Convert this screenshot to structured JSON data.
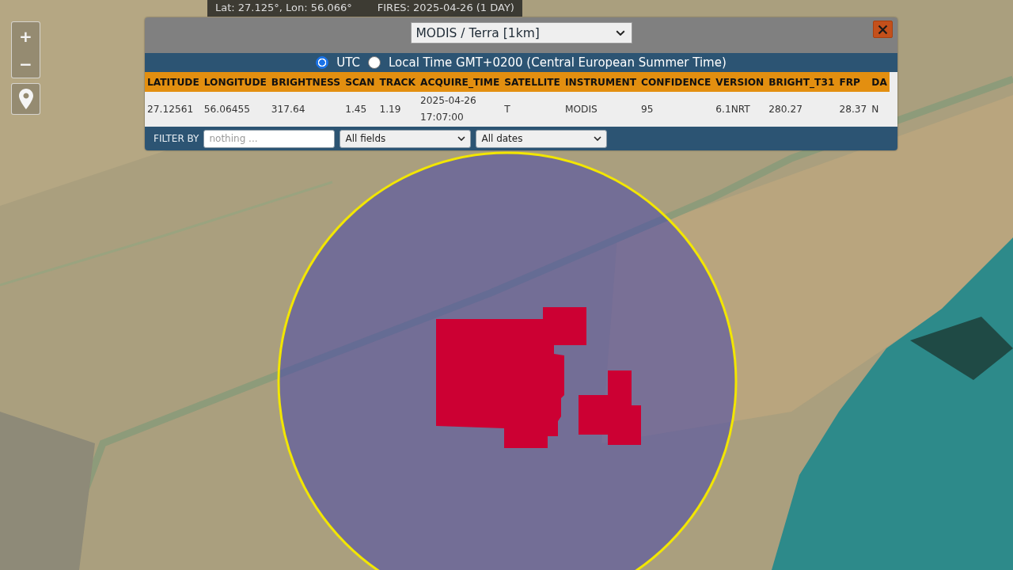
{
  "status_bar": {
    "coordinates": "Lat: 27.125°, Lon: 56.066°",
    "fires": "FIRES: 2025-04-26 (1 DAY)"
  },
  "map_controls": {
    "zoom_in": "+",
    "zoom_out": "−"
  },
  "popup": {
    "source_select": {
      "value": "MODIS / Terra [1km]"
    },
    "time_options": [
      {
        "label": "UTC",
        "selected": true
      },
      {
        "label": "Local Time GMT+0200 (Central European Summer Time)",
        "selected": false
      }
    ],
    "table": {
      "columns": [
        "LATITUDE",
        "LONGITUDE",
        "BRIGHTNESS",
        "SCAN",
        "TRACK",
        "ACQUIRE_TIME",
        "SATELLITE",
        "INSTRUMENT",
        "CONFIDENCE",
        "VERSION",
        "BRIGHT_T31",
        "FRP",
        "DA"
      ],
      "rows": [
        [
          "27.12561",
          "56.06455",
          "317.64",
          "1.45",
          "1.19",
          "2025-04-26 17:07:00",
          "T",
          "MODIS",
          "95",
          "6.1NRT",
          "280.27",
          "28.37",
          "N"
        ]
      ]
    },
    "filter": {
      "label": "FILTER BY",
      "search": {
        "placeholder": "nothing ..."
      },
      "field_select": {
        "value": "All fields"
      },
      "date_select": {
        "value": "All dates"
      }
    }
  }
}
